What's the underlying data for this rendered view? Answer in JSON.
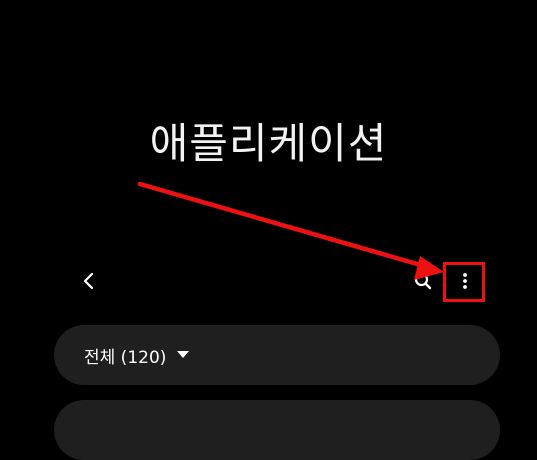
{
  "page": {
    "title": "애플리케이션"
  },
  "toolbar": {
    "back_icon": "chevron-left-icon",
    "search_icon": "search-icon",
    "more_icon": "more-vertical-icon"
  },
  "filter": {
    "label": "전체 (120)",
    "dropdown_icon": "caret-down-icon"
  },
  "annotation": {
    "arrow_color": "#ee1111",
    "highlight_color": "#ee1111"
  },
  "colors": {
    "background": "#000000",
    "card": "#1f1f1f",
    "text": "#ffffff"
  }
}
